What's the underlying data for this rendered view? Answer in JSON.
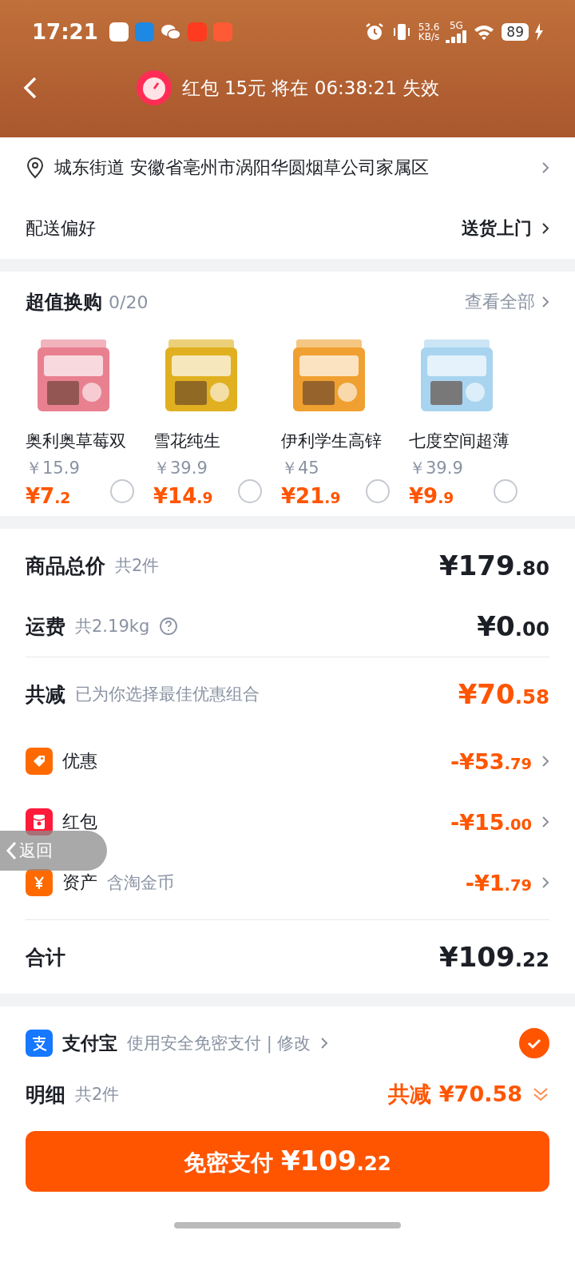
{
  "status_bar": {
    "time": "17:21",
    "speed": "53.6",
    "speed_unit": "KB/s",
    "network": "5G",
    "battery": "89"
  },
  "header": {
    "countdown": "红包 15元 将在 06:38:21 失效"
  },
  "address": {
    "text": "城东街道 安徽省亳州市涡阳华圆烟草公司家属区"
  },
  "delivery": {
    "label": "配送偏好",
    "value": "送货上门"
  },
  "exchange": {
    "title": "超值换购",
    "count": "0/20",
    "view_all": "查看全部",
    "products": [
      {
        "name": "奥利奥草莓双",
        "original_price": "￥15.9",
        "price": "¥7.2",
        "selected": false,
        "color": "#e8808f"
      },
      {
        "name": "雪花纯生",
        "original_price": "￥39.9",
        "price": "¥14.9",
        "selected": false,
        "color": "#e0b020"
      },
      {
        "name": "伊利学生高锌",
        "original_price": "￥45",
        "price": "¥21.9",
        "selected": false,
        "color": "#f0a030"
      },
      {
        "name": "七度空间超薄",
        "original_price": "￥39.9",
        "price": "¥9.9",
        "selected": false,
        "color": "#a8d4f0"
      }
    ]
  },
  "summary": {
    "rows": [
      {
        "kind": "plain",
        "label": "商品总价",
        "note": "共2件",
        "amount": "¥179.80"
      },
      {
        "kind": "help",
        "label": "运费",
        "note": "共2.19kg",
        "amount": "¥0.00"
      },
      {
        "kind": "discount",
        "label": "共减",
        "note": "已为你选择最佳优惠组合",
        "amount": "¥70.58"
      }
    ],
    "items": [
      {
        "kind": "coupon",
        "label": "优惠",
        "amount": "-¥53.79"
      },
      {
        "kind": "redpacket",
        "label": "红包",
        "amount": "-¥15.00"
      },
      {
        "kind": "asset",
        "label": "资产",
        "note": "含淘金币",
        "amount": "-¥1.79"
      }
    ],
    "total": {
      "label": "合计",
      "amount": "¥109.22"
    }
  },
  "payment": {
    "method": "支付宝",
    "note": "使用安全免密支付 | 修改",
    "selected": true
  },
  "detail": {
    "label": "明细",
    "note": "共2件",
    "discount": "共减 ¥70.58"
  },
  "pay_button": {
    "label": "免密支付",
    "amount": "¥109.22"
  },
  "back_overlay": {
    "label": "返回"
  }
}
